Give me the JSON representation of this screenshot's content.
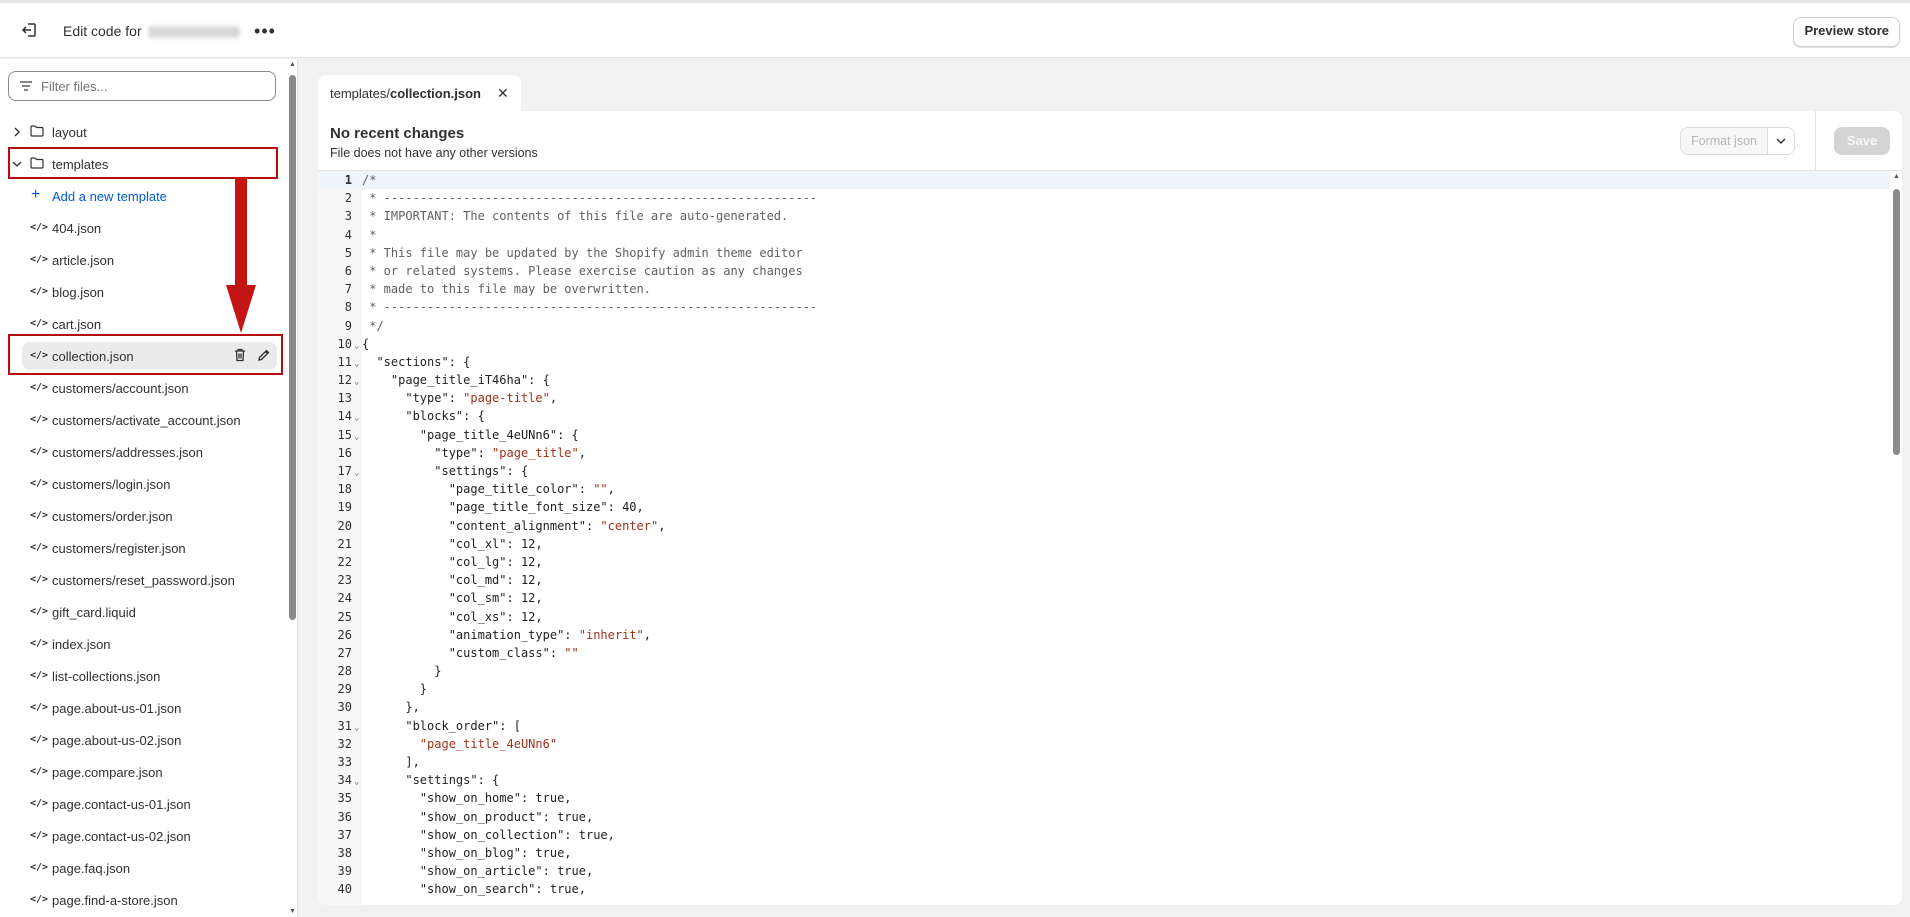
{
  "topbar": {
    "title_prefix": "Edit code for",
    "more_label": "•••",
    "preview_label": "Preview store"
  },
  "sidebar": {
    "filter_placeholder": "Filter files...",
    "folders": [
      {
        "name": "layout",
        "expanded": false
      },
      {
        "name": "templates",
        "expanded": true
      }
    ],
    "add_template_label": "Add a new template",
    "files": [
      "404.json",
      "article.json",
      "blog.json",
      "cart.json",
      "collection.json",
      "customers/account.json",
      "customers/activate_account.json",
      "customers/addresses.json",
      "customers/login.json",
      "customers/order.json",
      "customers/register.json",
      "customers/reset_password.json",
      "gift_card.liquid",
      "index.json",
      "list-collections.json",
      "page.about-us-01.json",
      "page.about-us-02.json",
      "page.compare.json",
      "page.contact-us-01.json",
      "page.contact-us-02.json",
      "page.faq.json",
      "page.find-a-store.json"
    ],
    "selected_file": "collection.json"
  },
  "editor": {
    "tab_folder": "templates/",
    "tab_file": "collection.json",
    "header_title": "No recent changes",
    "header_subtitle": "File does not have any other versions",
    "format_label": "Format json",
    "save_label": "Save",
    "lines": [
      "/*",
      " * ------------------------------------------------------------",
      " * IMPORTANT: The contents of this file are auto-generated.",
      " *",
      " * This file may be updated by the Shopify admin theme editor",
      " * or related systems. Please exercise caution as any changes",
      " * made to this file may be overwritten.",
      " * ------------------------------------------------------------",
      " */",
      "{",
      "  \"sections\": {",
      "    \"page_title_iT46ha\": {",
      "      \"type\": \"page-title\",",
      "      \"blocks\": {",
      "        \"page_title_4eUNn6\": {",
      "          \"type\": \"page_title\",",
      "          \"settings\": {",
      "            \"page_title_color\": \"\",",
      "            \"page_title_font_size\": 40,",
      "            \"content_alignment\": \"center\",",
      "            \"col_xl\": 12,",
      "            \"col_lg\": 12,",
      "            \"col_md\": 12,",
      "            \"col_sm\": 12,",
      "            \"col_xs\": 12,",
      "            \"animation_type\": \"inherit\",",
      "            \"custom_class\": \"\"",
      "          }",
      "        }",
      "      },",
      "      \"block_order\": [",
      "        \"page_title_4eUNn6\"",
      "      ],",
      "      \"settings\": {",
      "        \"show_on_home\": true,",
      "        \"show_on_product\": true,",
      "        \"show_on_collection\": true,",
      "        \"show_on_blog\": true,",
      "        \"show_on_article\": true,",
      "        \"show_on_search\": true,"
    ],
    "fold_lines": [
      10,
      11,
      12,
      14,
      15,
      17,
      31,
      34
    ]
  }
}
